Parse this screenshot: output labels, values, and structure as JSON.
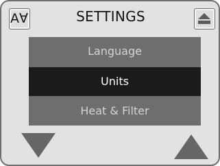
{
  "header": {
    "title": "SETTINGS",
    "font_button_glyph": "A∀",
    "home_icon": "eject-home-icon"
  },
  "menu": {
    "items": [
      {
        "label": "Language",
        "selected": false
      },
      {
        "label": "Units",
        "selected": true
      },
      {
        "label": "Heat & Filter",
        "selected": false
      }
    ]
  },
  "controls": {
    "down_icon": "triangle-down-icon",
    "up_icon": "triangle-up-icon"
  },
  "colors": {
    "frame": "#6e6e6e",
    "background": "#e2e2e2",
    "menu_background": "#6e6e6e",
    "selected_background": "#1b1b1b",
    "arrow_fill": "#666666"
  }
}
